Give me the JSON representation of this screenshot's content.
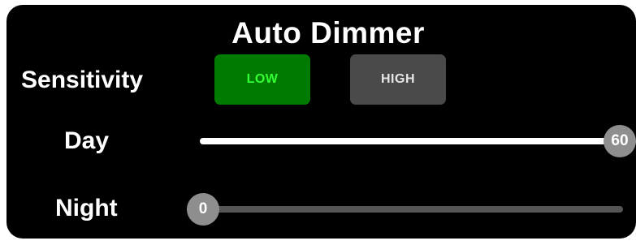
{
  "title": "Auto Dimmer",
  "sensitivity": {
    "label": "Sensitivity",
    "options": [
      {
        "label": "LOW",
        "selected": true
      },
      {
        "label": "HIGH",
        "selected": false
      }
    ]
  },
  "day": {
    "label": "Day",
    "value": "60",
    "fraction": 1.0
  },
  "night": {
    "label": "Night",
    "value": "0",
    "fraction": 0.0
  },
  "colors": {
    "panel_bg": "#000000",
    "selected_button": "#007a00",
    "selected_text": "#33ff33",
    "unselected_button": "#4a4a4a",
    "slider_fill": "#ffffff",
    "slider_track": "#555555",
    "thumb": "#8e8e8e"
  }
}
